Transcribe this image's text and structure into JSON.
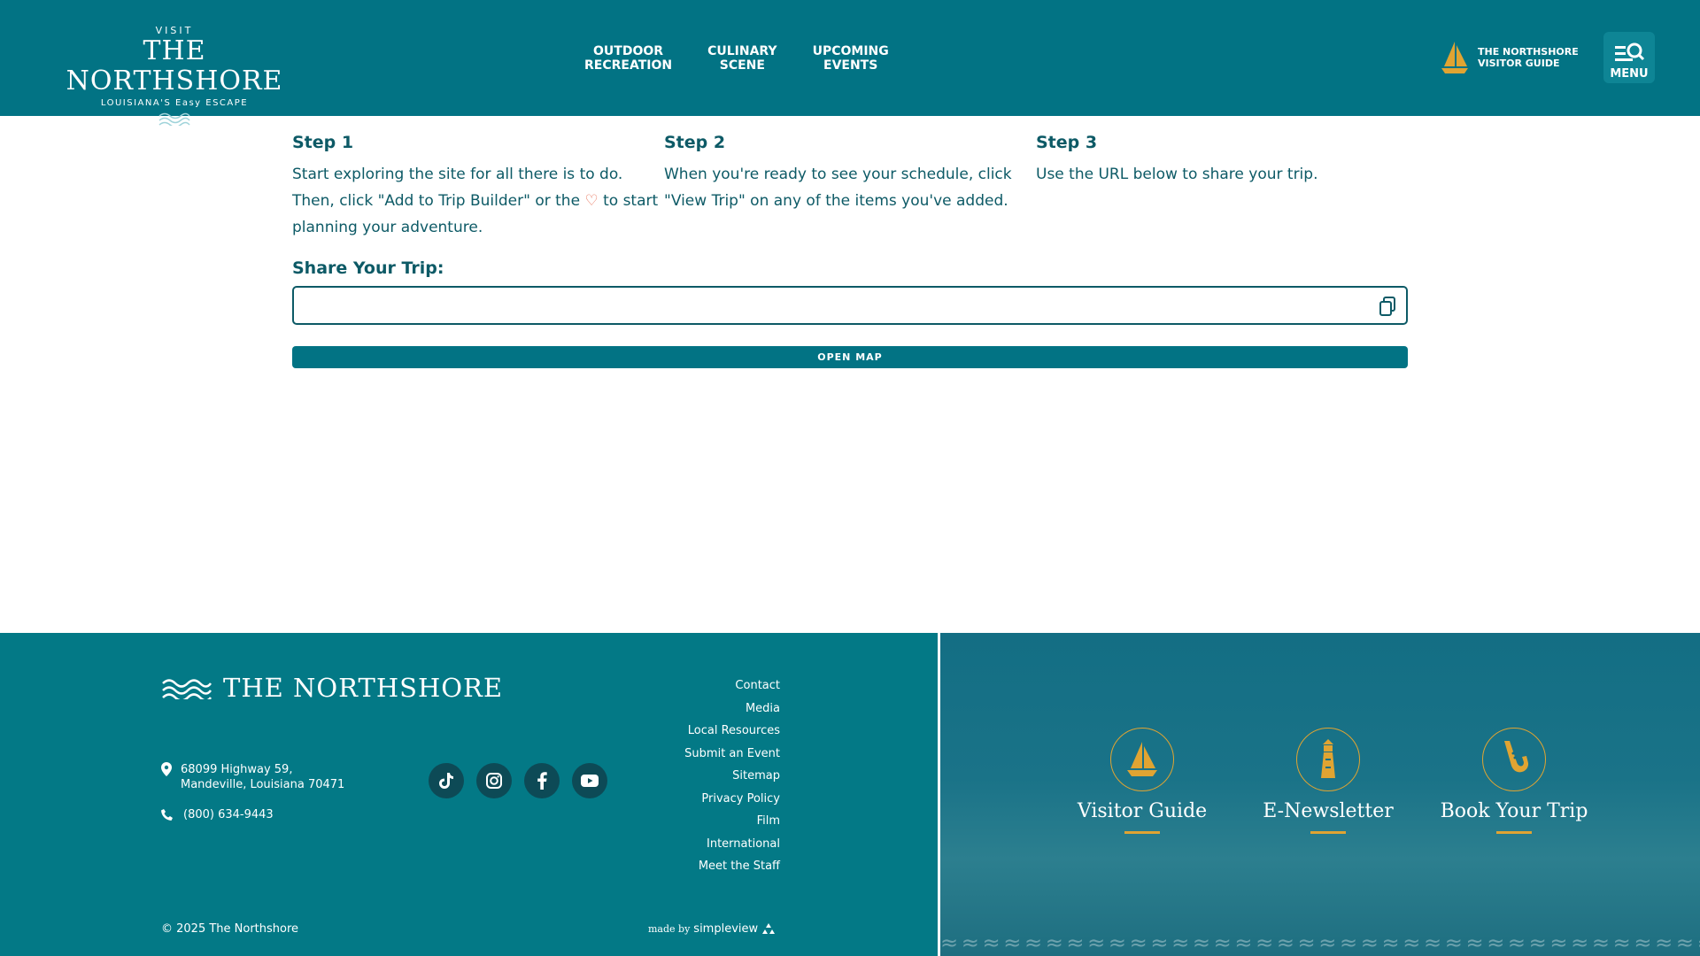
{
  "header": {
    "logo": {
      "visit": "VISIT",
      "name": "THE NORTHSHORE",
      "tagline": "LOUISIANA'S Easy ESCAPE"
    },
    "nav": [
      {
        "line1": "OUTDOOR",
        "line2": "RECREATION"
      },
      {
        "line1": "CULINARY",
        "line2": "SCENE"
      },
      {
        "line1": "UPCOMING",
        "line2": "EVENTS"
      }
    ],
    "guide": {
      "line1": "THE NORTHSHORE",
      "line2": "VISITOR GUIDE"
    },
    "menu_label": "MENU"
  },
  "steps": [
    {
      "title": "Step 1",
      "text_before": "Start exploring the site for all there is to do. Then, click \"Add to Trip Builder\" or the",
      "text_after": "to start planning your adventure."
    },
    {
      "title": "Step 2",
      "text": "When you're ready to see your schedule, click \"View Trip\" on any of the items you've added."
    },
    {
      "title": "Step 3",
      "text": "Use the URL below to share your trip."
    }
  ],
  "share": {
    "title": "Share Your Trip:",
    "value": "",
    "button": "OPEN MAP"
  },
  "footer": {
    "logo_name": "THE NORTHSHORE",
    "address_line1": "68099 Highway 59,",
    "address_line2": "Mandeville, Louisiana 70471",
    "phone": "(800) 634-9443",
    "socials": [
      "tiktok-icon",
      "instagram-icon",
      "facebook-icon",
      "youtube-icon"
    ],
    "links": [
      "Contact",
      "Media",
      "Local Resources",
      "Submit an Event",
      "Sitemap",
      "Privacy Policy",
      "Film",
      "International",
      "Meet the Staff"
    ],
    "copyright": "© 2025 The Northshore",
    "madeby_prefix": "made by",
    "madeby_brand": "simpleview",
    "ctas": [
      "Visitor Guide",
      "E-Newsletter",
      "Book Your Trip"
    ]
  },
  "colors": {
    "header_bg": "#027384",
    "text_dark": "#0d5a66",
    "accent_gold": "#e0a432",
    "heart": "#e8735a"
  }
}
